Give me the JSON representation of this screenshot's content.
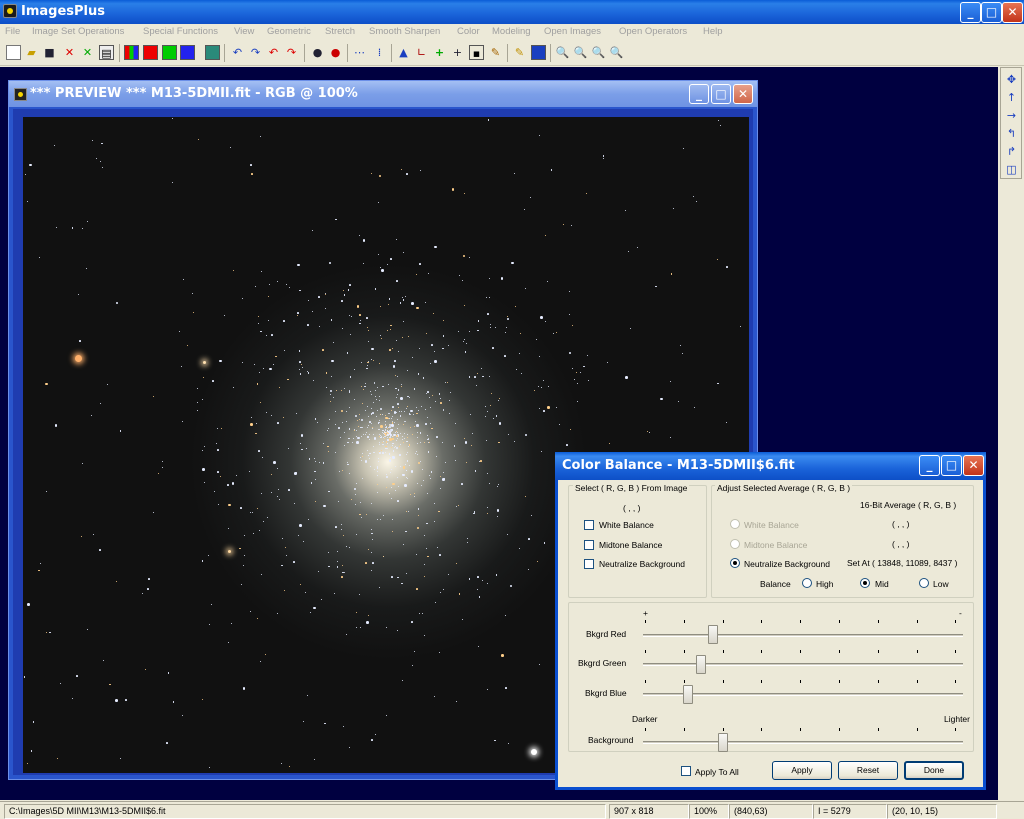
{
  "app": {
    "title": "ImagesPlus",
    "menu": [
      "File",
      "Image Set Operations",
      "Special Functions",
      "View",
      "Geometric",
      "Stretch",
      "Smooth Sharpen",
      "Color",
      "Modeling",
      "Open Images",
      "Open Operators",
      "Help"
    ]
  },
  "toolbar": {
    "icons": [
      "new-file-icon",
      "open-folder-icon",
      "save-icon",
      "close-red-icon",
      "close-green-icon",
      "print-icon",
      "rgb-bars-icon",
      "red-channel-icon",
      "green-channel-icon",
      "blue-channel-icon",
      "grid-icon",
      "undo-icon",
      "redo-icon",
      "undo-red-icon",
      "redo-red-icon",
      "circle-dark-icon",
      "circle-red-icon",
      "dots-icon",
      "dots-alt-icon",
      "triangle-icon",
      "histogram-icon",
      "plus-green-icon",
      "crosshair-icon",
      "frame-icon",
      "pencil-chart-icon",
      "pencil-icon",
      "mosaic-icon",
      "zoom-in-icon",
      "zoom-out-icon",
      "zoom-fit-icon",
      "zoom-actual-icon"
    ]
  },
  "right_toolbar": {
    "icons": [
      "move-arrows-icon",
      "arrow-up-icon",
      "arrow-right-icon",
      "rotate-left-icon",
      "rotate-right-icon",
      "flip-icon"
    ]
  },
  "preview": {
    "title": "*** PREVIEW *** M13-5DMII.fit - RGB @ 100%"
  },
  "dialog": {
    "title": "Color Balance - M13-5DMII$6.fit",
    "select_group": {
      "title": "Select ( R, G, B ) From Image",
      "value": "( , , )",
      "options": [
        "White Balance",
        "Midtone Balance",
        "Neutralize Background"
      ]
    },
    "adjust_group": {
      "title": "Adjust Selected Average ( R, G, B )",
      "avg_header": "16-Bit Average ( R, G, B )",
      "options": [
        "White Balance",
        "Midtone Balance",
        "Neutralize Background"
      ],
      "values": [
        "( , , )",
        "( , , )"
      ],
      "set_at": "Set At ( 13848, 11089, 8437 )",
      "balance_label": "Balance",
      "balance_options": [
        "High",
        "Mid",
        "Low"
      ],
      "balance_selected": "Mid"
    },
    "sliders": {
      "plus_label": "+",
      "minus_label": "-",
      "red_label": "Bkgrd Red",
      "red_value": 0.22,
      "green_label": "Bkgrd Green",
      "green_value": 0.18,
      "blue_label": "Bkgrd Blue",
      "blue_value": 0.14,
      "darker_label": "Darker",
      "lighter_label": "Lighter",
      "background_label": "Background",
      "background_value": 0.25
    },
    "apply_to_all": "Apply To All",
    "buttons": {
      "apply": "Apply",
      "reset": "Reset",
      "done": "Done"
    }
  },
  "status": {
    "path": "C:\\Images\\5D MII\\M13\\M13-5DMII$6.fit",
    "dims": "907 x 818",
    "zoom": "100%",
    "coords": "(840,63)",
    "intensity": "I = 5279",
    "rgb": "(20, 10, 15)"
  }
}
